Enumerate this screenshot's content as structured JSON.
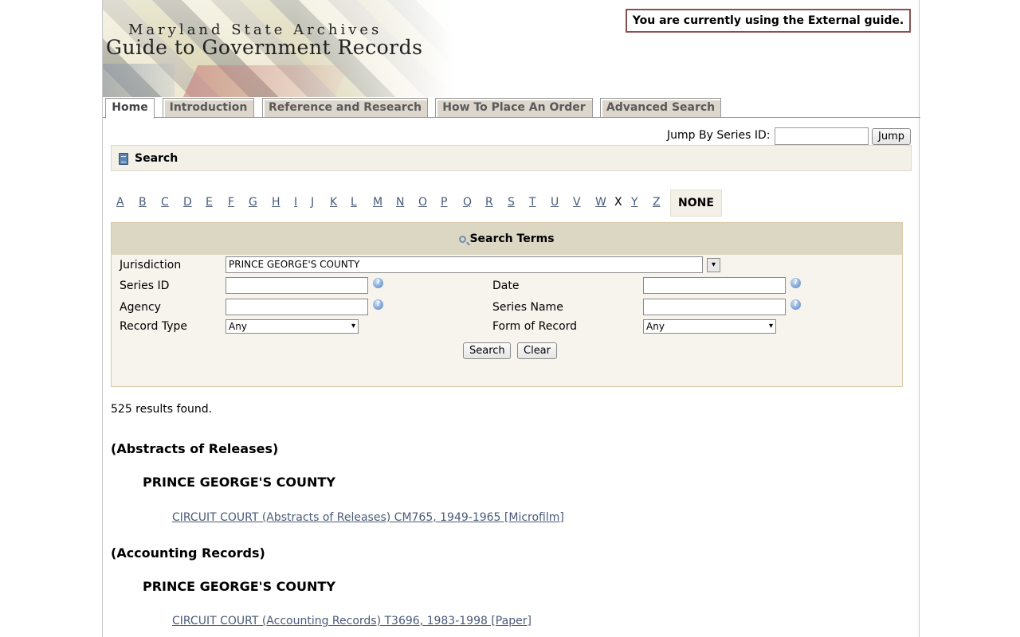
{
  "header": {
    "archives_title": "Maryland State Archives",
    "guide_title": "Guide to Government Records",
    "guide_notice": "You are currently using the External guide."
  },
  "tabs": [
    {
      "label": "Home",
      "active": true
    },
    {
      "label": "Introduction",
      "active": false
    },
    {
      "label": "Reference and Research",
      "active": false
    },
    {
      "label": "How To Place An Order",
      "active": false
    },
    {
      "label": "Advanced Search",
      "active": false
    }
  ],
  "jump": {
    "label": "Jump By Series ID:",
    "value": "",
    "button": "Jump"
  },
  "search_bar": {
    "title": "Search"
  },
  "alphabet": {
    "letters": [
      "A",
      "B",
      "C",
      "D",
      "E",
      "F",
      "G",
      "H",
      "I",
      "J",
      "K",
      "L",
      "M",
      "N",
      "O",
      "P",
      "Q",
      "R",
      "S",
      "T",
      "U",
      "V",
      "W",
      "X",
      "Y",
      "Z"
    ],
    "unlinked": "X",
    "selected": "NONE"
  },
  "search_terms": {
    "title": "Search Terms",
    "jurisdiction_label": "Jurisdiction",
    "jurisdiction_value": "PRINCE GEORGE'S COUNTY",
    "series_id_label": "Series ID",
    "series_id_value": "",
    "date_label": "Date",
    "date_value": "",
    "agency_label": "Agency",
    "agency_value": "",
    "series_name_label": "Series Name",
    "series_name_value": "",
    "record_type_label": "Record Type",
    "record_type_value": "Any",
    "form_label": "Form of Record",
    "form_value": "Any",
    "search_button": "Search",
    "clear_button": "Clear"
  },
  "results": {
    "count_text": "525 results found.",
    "groups": [
      {
        "heading": "(Abstracts of Releases)",
        "county": "PRINCE GEORGE'S COUNTY",
        "link": "CIRCUIT COURT (Abstracts of Releases) CM765, 1949-1965 [Microfilm]"
      },
      {
        "heading": "(Accounting Records)",
        "county": "PRINCE GEORGE'S COUNTY",
        "link": "CIRCUIT COURT (Accounting Records) T3696, 1983-1998 [Paper]"
      }
    ]
  },
  "icons": {
    "help": "?",
    "dropdown": "▾"
  }
}
